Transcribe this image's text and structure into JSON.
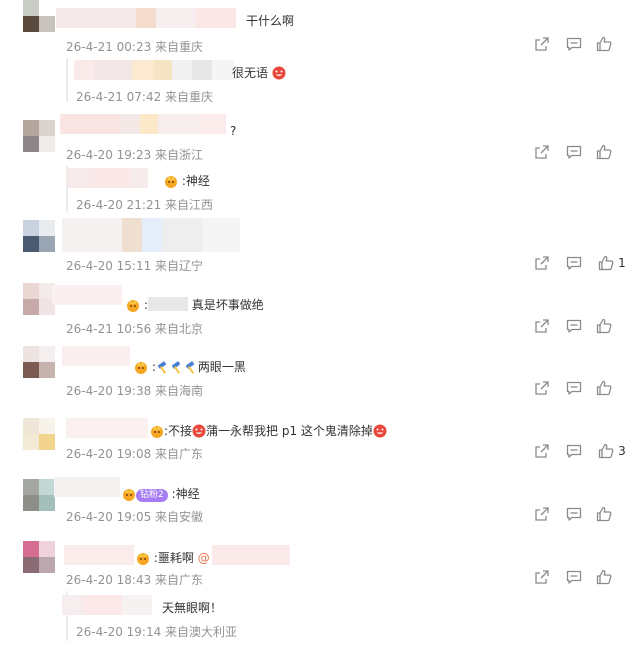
{
  "colors": {
    "meta": "#939393",
    "text": "#333333",
    "mention": "#eb7350",
    "badge": "#f5a623",
    "emoji_red": "#e8473b",
    "vip_purple": "#a57cf2"
  },
  "icons": {
    "share": "share-icon",
    "comment": "comment-icon",
    "like": "like-icon",
    "badge": "fan-badge-icon",
    "emoji": "emoji-icon"
  },
  "comments": [
    {
      "text": "干什么啊",
      "meta": "26-4-21 00:23 来自重庆",
      "like_count": "",
      "reply": {
        "text": "很无语",
        "meta": "26-4-21 07:42 来自重庆"
      }
    },
    {
      "text": "?",
      "meta": "26-4-20 19:23 来自浙江",
      "like_count": "",
      "reply": {
        "text": ":神经",
        "meta": "26-4-20 21:21 来自江西"
      }
    },
    {
      "text": "",
      "meta": "26-4-20 15:11 来自辽宁",
      "like_count": "1"
    },
    {
      "text": "真是坏事做绝",
      "meta": "26-4-21 10:56 来自北京",
      "like_count": ""
    },
    {
      "text": "两眼一黑",
      "meta": "26-4-20 19:38 来自海南",
      "like_count": ""
    },
    {
      "text_a": ":不接",
      "text_b": "蒲一永帮我把 p1 这个鬼清除掉",
      "meta": "26-4-20 19:08 来自广东",
      "like_count": "3"
    },
    {
      "vip": "钻粉2",
      "text": ":神经",
      "meta": "26-4-20 19:05 来自安徽",
      "like_count": ""
    },
    {
      "text": ":噩耗啊",
      "mention": "@",
      "meta": "26-4-20 18:43 来自广东",
      "like_count": "",
      "reply": {
        "text": "天無眼啊！",
        "meta": "26-4-20 19:14 来自澳大利亚"
      }
    }
  ]
}
